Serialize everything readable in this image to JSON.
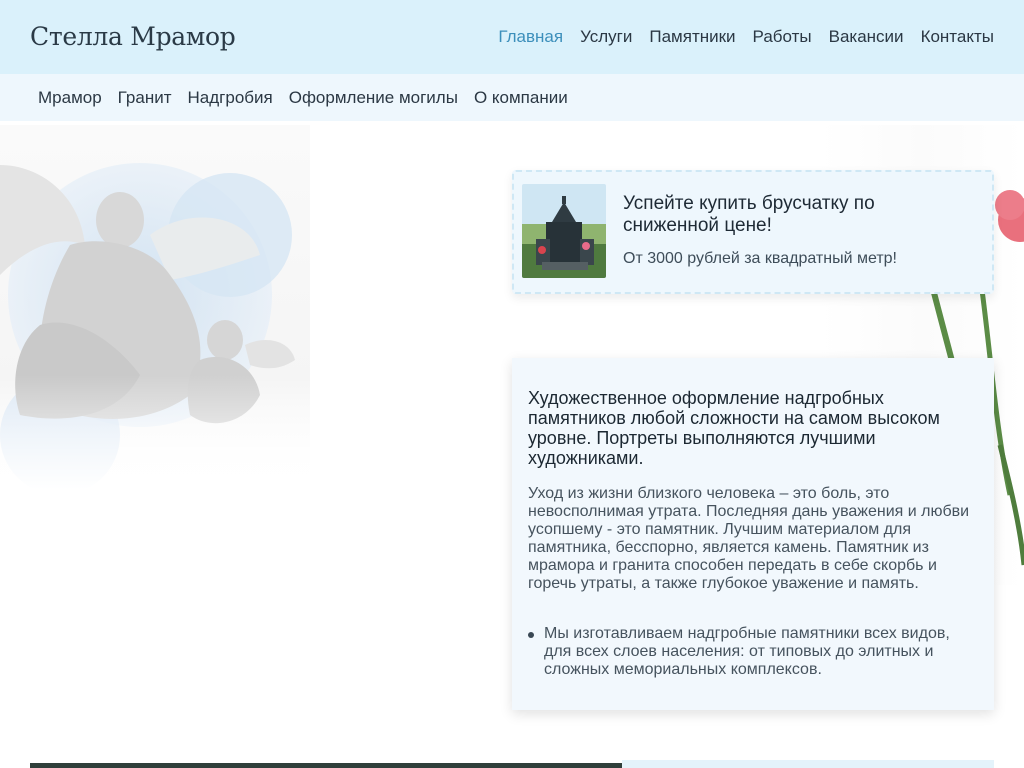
{
  "header": {
    "logo": "Стелла Мрамор",
    "nav": [
      {
        "label": "Главная",
        "active": true
      },
      {
        "label": "Услуги"
      },
      {
        "label": "Памятники"
      },
      {
        "label": "Работы"
      },
      {
        "label": "Вакансии"
      },
      {
        "label": "Контакты"
      }
    ]
  },
  "subnav": [
    {
      "label": "Мрамор"
    },
    {
      "label": "Гранит"
    },
    {
      "label": "Надгробия"
    },
    {
      "label": "Оформление могилы"
    },
    {
      "label": "О компании"
    }
  ],
  "promo": {
    "title": "Успейте купить брусчатку по сниженной цене!",
    "subtitle": "От 3000 рублей за квадратный метр!"
  },
  "info": {
    "title": "Художественное оформление надгробных памятников любой сложности на самом высоком уровне. Портреты выполняются лучшими художниками.",
    "body": "Уход из жизни близкого человека – это боль, это невосполнимая утрата. Последняя дань уважения и любви усопшему - это памятник. Лучшим материалом для памятника, бесспорно, является камень. Памятник из мрамора и гранита способен передать в себе скорбь и горечь утраты, а также глубокое уважение и память.",
    "list": [
      "Мы изготавливаем надгробные памятники всех видов, для всех слоев населения: от типовых до элитных и сложных мемориальных комплексов."
    ]
  },
  "colors": {
    "header_bg": "#daf1fb",
    "subnav_bg": "#eef7fd",
    "active_link": "#3c8fbb",
    "card_bg": "#f2f8fd"
  }
}
